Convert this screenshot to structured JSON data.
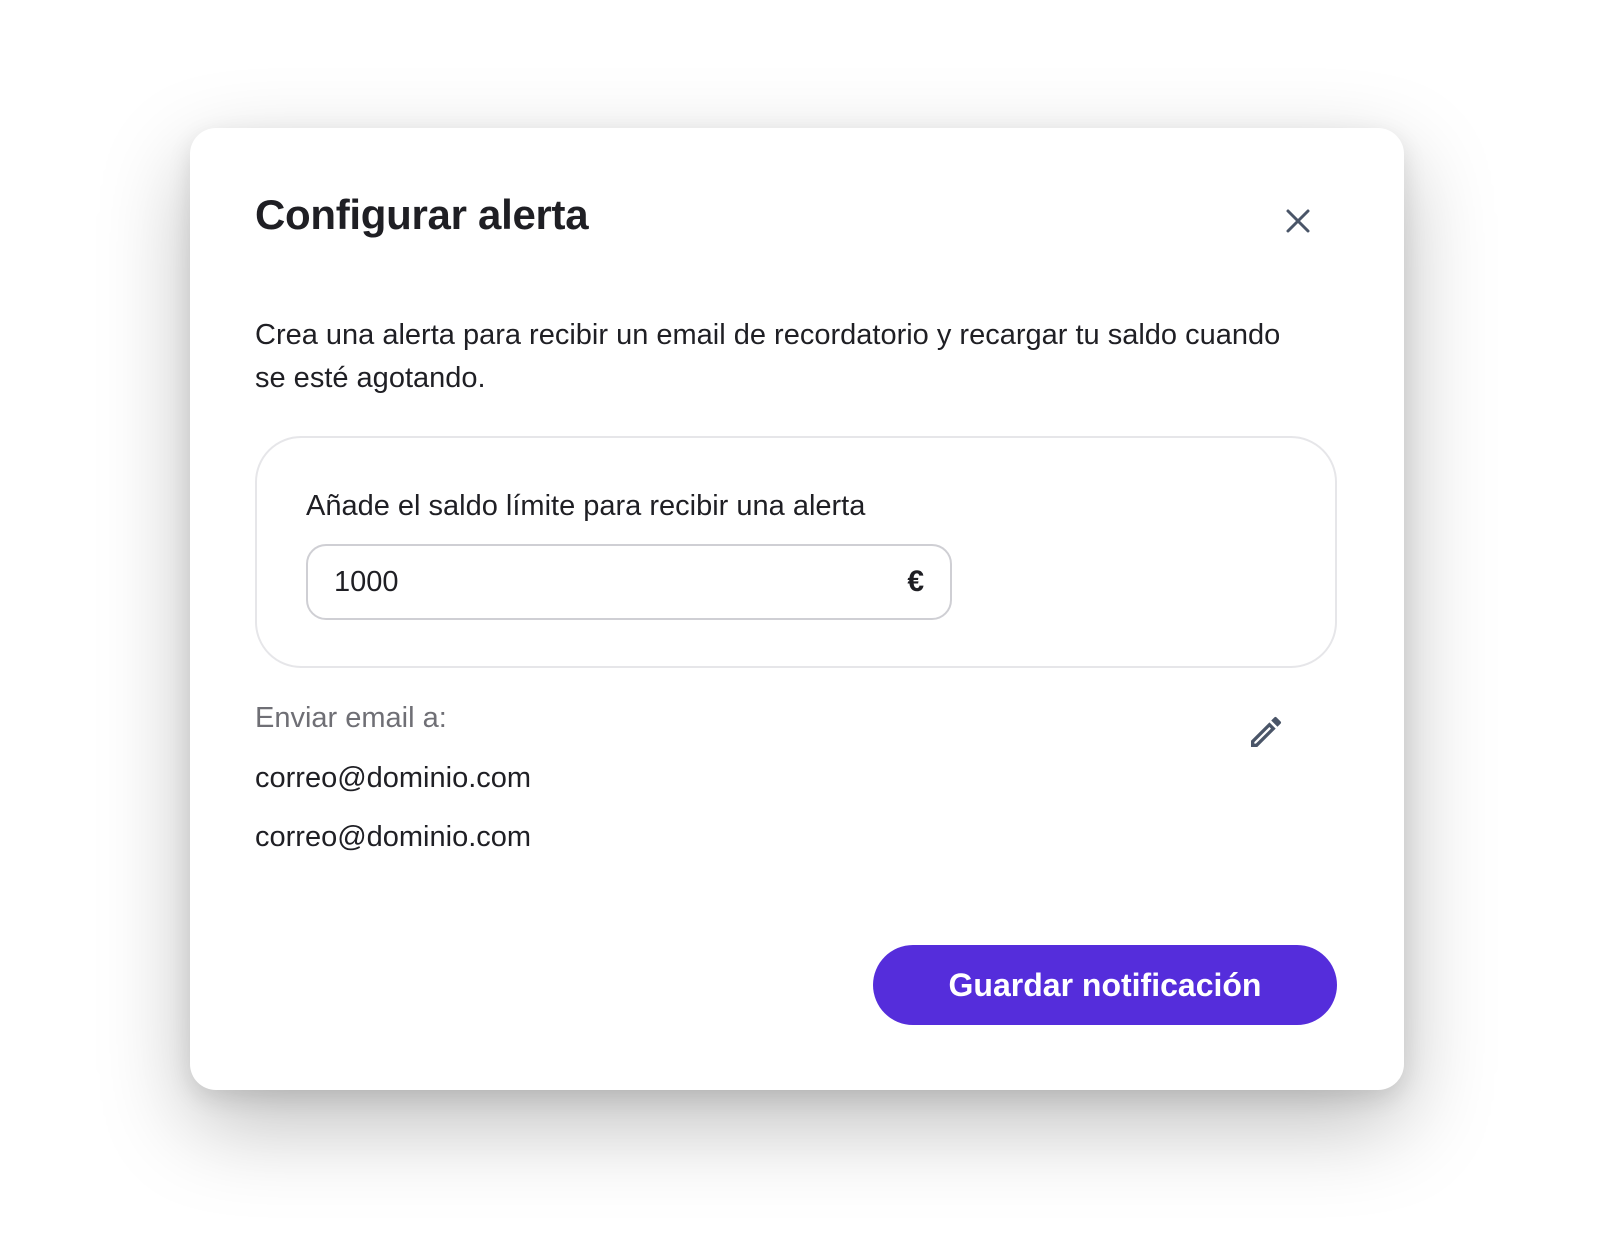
{
  "modal": {
    "title": "Configurar alerta",
    "close_icon": "close-icon",
    "description": "Crea una alerta para recibir un email de recordatorio y recargar tu saldo cuando se esté agotando.",
    "limit": {
      "label": "Añade el saldo límite para recibir una alerta",
      "value": "1000",
      "currency": "€"
    },
    "recipients": {
      "label": "Enviar email a:",
      "edit_icon": "pencil-icon",
      "emails": [
        "correo@dominio.com",
        "correo@dominio.com"
      ]
    },
    "save_label": "Guardar notificación"
  },
  "colors": {
    "primary": "#552ddb",
    "text": "#1f1f24",
    "muted": "#6f6f75",
    "icon": "#4a5568"
  }
}
